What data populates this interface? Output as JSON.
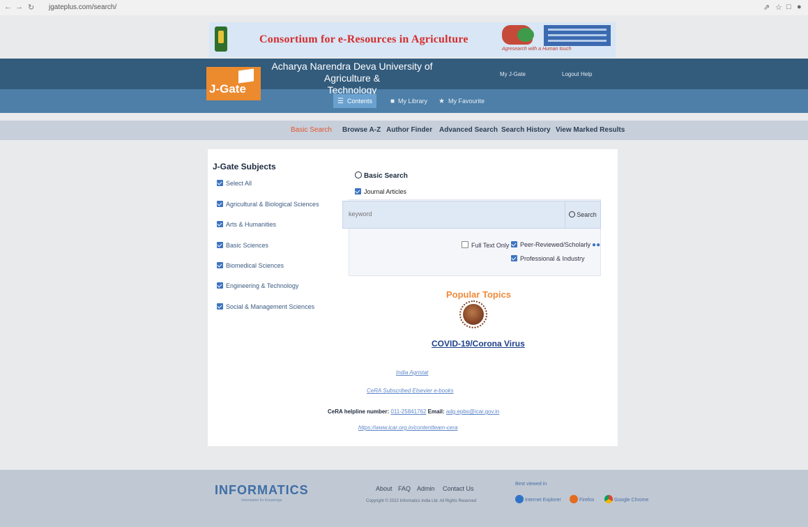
{
  "browser": {
    "url": "jgateplus.com/search/"
  },
  "banner": {
    "title": "Consortium for e-Resources in Agriculture",
    "tagline": "Agresearch with a Human touch"
  },
  "header": {
    "logo": "J-Gate",
    "university_line1": "Acharya Narendra Deva University of Agriculture &",
    "university_line2": "Technology",
    "my_jgate": "My J-Gate",
    "logout": "Logout",
    "help": "Help"
  },
  "tabs": {
    "contents": "Contents",
    "my_library": "My Library",
    "my_favourite": "My Favourite"
  },
  "subnav": {
    "basic_search": "Basic Search",
    "browse": "Browse A-Z",
    "author_finder": "Author Finder",
    "advanced_search": "Advanced Search",
    "search_history": "Search History",
    "view_marked": "View Marked Results"
  },
  "subjects": {
    "title": "J-Gate Subjects",
    "items": [
      "Select All",
      "Agricultural & Biological Sciences",
      "Arts & Humanities",
      "Basic Sciences",
      "Biomedical Sciences",
      "Engineering & Technology",
      "Social & Management Sciences"
    ]
  },
  "search": {
    "heading": "Basic Search",
    "journal_articles": "Journal Articles",
    "placeholder": "keyword",
    "button": "Search",
    "full_text_only": "Full Text Only",
    "peer_reviewed": "Peer-Reviewed/Scholarly",
    "professional": "Professional & Industry"
  },
  "popular": {
    "heading": "Popular Topics",
    "covid": "COVID-19/Corona Virus",
    "india_agristat": "India Agristat",
    "cera_ebooks": "CeRA Subscribed Elsevier e-books",
    "helpline_label": "CeRA helpline number:",
    "helpline_number": "011-25841762",
    "email_label": "Email:",
    "email": "adg.epbs@icar.gov.in",
    "contentteam": "https://www.icar.org.in/contentteam-cera"
  },
  "footer": {
    "logo": "INFORMATICS",
    "logo_sub": "Information for Knowledge",
    "about": "About",
    "faq": "FAQ",
    "admin": "Admin",
    "contact": "Contact Us",
    "copyright": "Copyright © 2022 Informatics India Ltd. All Rights Reserved",
    "best_viewed": "Best viewed in",
    "browsers": [
      "Internet Explorer",
      "Firefox",
      "Google Chrome"
    ]
  }
}
